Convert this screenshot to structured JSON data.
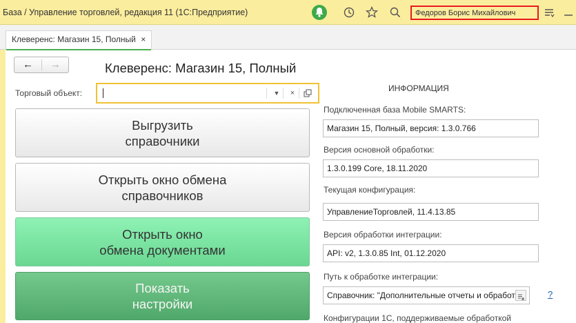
{
  "titlebar": {
    "app_title": "База / Управление торговлей, редакция 11  (1С:Предприятие)",
    "user_name": "Федоров Борис Михайлович",
    "icons": [
      "bell-icon",
      "history-icon",
      "star-icon",
      "search-icon",
      "menu-icon",
      "minimize-icon"
    ]
  },
  "tabs": [
    {
      "label": "Клеверенс: Магазин 15, Полный",
      "close": "×"
    }
  ],
  "nav": {
    "back": "←",
    "forward": "→"
  },
  "page_title": "Клеверенс: Магазин 15, Полный",
  "form": {
    "trade_object_label": "Торговый объект:",
    "trade_object_value": ""
  },
  "buttons": {
    "export_refs": "Выгрузить\nсправочники",
    "open_ref_exchange": "Открыть окно обмена\nсправочников",
    "open_doc_exchange": "Открыть окно\nобмена документами",
    "show_settings": "Показать\nнастройки"
  },
  "info": {
    "heading": "ИНФОРМАЦИЯ",
    "items": [
      {
        "label": "Подключенная база Mobile SMARTS:",
        "value": "Магазин 15, Полный, версия: 1.3.0.766"
      },
      {
        "label": "Версия основной обработки:",
        "value": "1.3.0.199 Core, 18.11.2020"
      },
      {
        "label": "Текущая конфигурация:",
        "value": "УправлениеТорговлей, 11.4.13.85"
      },
      {
        "label": "Версия обработки интеграции:",
        "value": "API: v2, 1.3.0.85 Int, 01.12.2020"
      },
      {
        "label": "Путь к обработке интеграции:",
        "value": "Справочник: \"Дополнительные отчеты и обработки\""
      }
    ],
    "help": "?",
    "footer_label": "Конфигурации 1С, поддерживаемые обработкой"
  },
  "colors": {
    "titlebar_bg": "#fbed9e",
    "user_box_border": "#e8181e",
    "field_focus_border": "#f1c232",
    "btn_green_light": "#7ee3a4",
    "btn_green_dark": "#5cb578",
    "tab_underline": "#4caf50"
  }
}
